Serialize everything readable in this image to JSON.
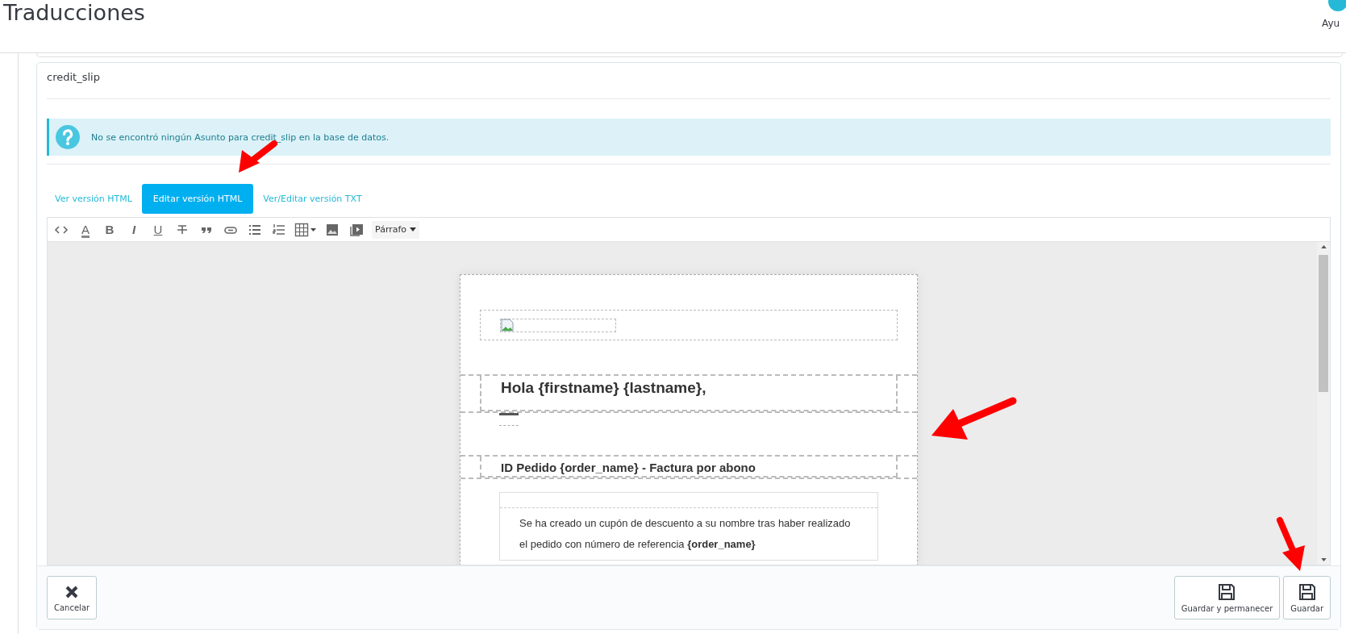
{
  "page": {
    "title": "Traducciones",
    "help_label": "Ayu"
  },
  "card": {
    "title": "credit_slip",
    "alert": "No se encontró ningún Asunto para credit_slip en la base de datos."
  },
  "tabs": [
    {
      "label": "Ver versión HTML",
      "selected": false
    },
    {
      "label": "Editar versión HTML",
      "selected": true
    },
    {
      "label": "Ver/Editar versión TXT",
      "selected": false
    }
  ],
  "toolbar": [
    {
      "kind": "code"
    },
    {
      "kind": "color",
      "label": "A"
    },
    {
      "kind": "bold",
      "label": "B"
    },
    {
      "kind": "italic",
      "label": "I"
    },
    {
      "kind": "underline",
      "label": "U"
    },
    {
      "kind": "strike"
    },
    {
      "kind": "quote"
    },
    {
      "kind": "link"
    },
    {
      "kind": "ul"
    },
    {
      "kind": "ol"
    },
    {
      "kind": "table"
    },
    {
      "kind": "image"
    },
    {
      "kind": "video"
    }
  ],
  "paragraph_format": "Párrafo",
  "email": {
    "greeting": "Hola {firstname} {lastname},",
    "heading": "ID Pedido {order_name} - Factura por abono",
    "body": "Se ha creado un cupón de descuento a su nombre tras haber realizado el pedido con número de referencia **{order_name}**"
  },
  "buttons": [
    {
      "kind": "cancel",
      "label": "Cancelar"
    },
    {
      "kind": "save",
      "label": "Guardar y permanecer"
    },
    {
      "kind": "save",
      "label": "Guardar"
    }
  ]
}
